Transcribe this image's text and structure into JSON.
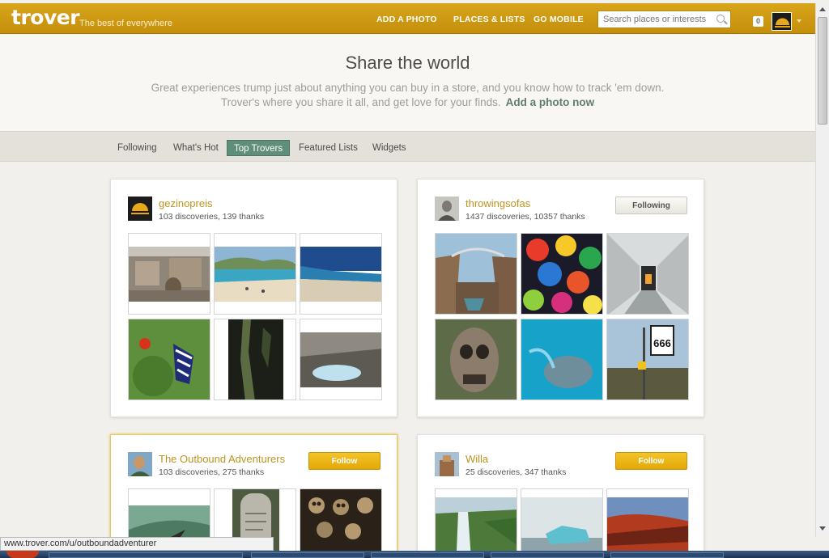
{
  "header": {
    "logo": "trover",
    "tagline": "The best of everywhere",
    "nav": [
      "ADD A PHOTO",
      "PLACES & LISTS",
      "GO MOBILE"
    ],
    "search_placeholder": "Search places or interests",
    "notification_count": "0"
  },
  "hero": {
    "title": "Share the world",
    "line1": "Great experiences trump just about anything you can buy in a store, and you know how to track 'em down.",
    "line2": "Trover's where you share it all, and get love for your finds.",
    "cta": "Add a photo now"
  },
  "tabs": [
    "Following",
    "What's Hot",
    "Top Trovers",
    "Featured Lists",
    "Widgets"
  ],
  "active_tab": "Top Trovers",
  "cards": [
    {
      "name": "gezinopreis",
      "stats": "103 discoveries, 139 thanks"
    },
    {
      "name": "throwingsofas",
      "stats": "1437 discoveries, 10357 thanks",
      "button": "Following"
    },
    {
      "name": "The Outbound Adventurers",
      "stats": "103 discoveries, 275 thanks",
      "button": "Follow"
    },
    {
      "name": "Willa",
      "stats": "25 discoveries, 347 thanks",
      "button": "Follow"
    }
  ],
  "status_bar": {
    "url": "www.trover.com/u/outboundadventurer"
  },
  "colors": {
    "header_gold": "#d4a218",
    "accent_green": "#5f8f7b",
    "username_gold": "#be9321"
  }
}
